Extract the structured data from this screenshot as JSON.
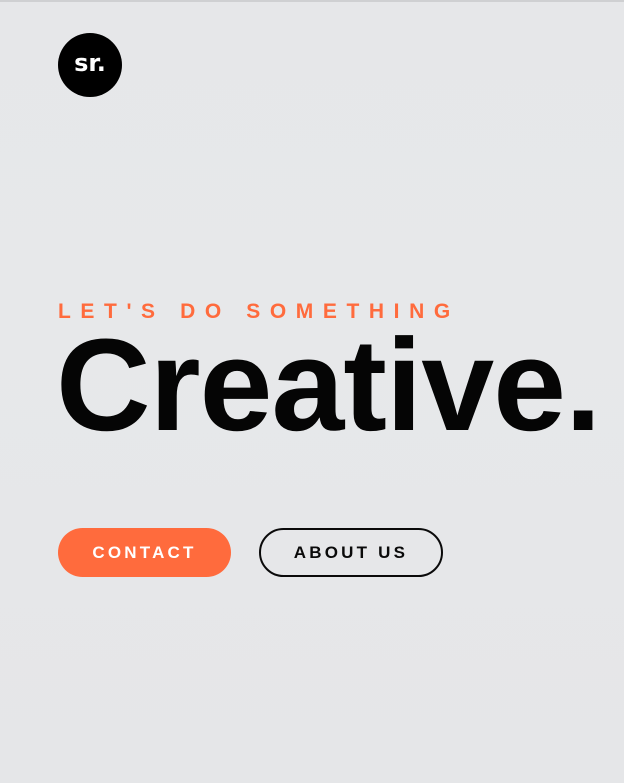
{
  "logo": {
    "text": "sr.",
    "background_color": "#000000",
    "text_color": "#ffffff"
  },
  "hero": {
    "eyebrow": "LET'S DO SOMETHING",
    "headline": "Creative."
  },
  "buttons": {
    "contact_label": "CONTACT",
    "about_label": "ABOUT US"
  },
  "colors": {
    "accent": "#ff6b3d",
    "background": "#e7e8ea",
    "text": "#050505"
  }
}
